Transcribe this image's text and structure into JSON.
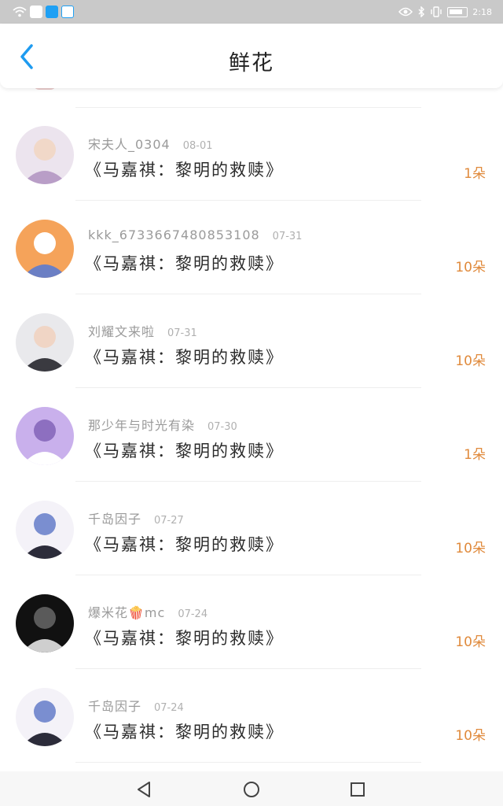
{
  "status_bar": {
    "time": "2:18",
    "icons": [
      "wifi-icon",
      "app-icon",
      "app-icon",
      "app-icon",
      "eye-icon",
      "bluetooth-icon",
      "vibrate-icon",
      "battery-icon"
    ]
  },
  "header": {
    "title": "鲜花",
    "back_icon": "chevron-left-icon"
  },
  "flowers": [
    {
      "username": "宋夫人_0304",
      "date": "08-01",
      "book": "《马嘉祺：黎明的救赎》",
      "count": "1朵",
      "avatar_colors": [
        "#ece4ee",
        "#b99ec7",
        "#f1d8c8"
      ]
    },
    {
      "username": "kkk_6733667480853108",
      "date": "07-31",
      "book": "《马嘉祺：黎明的救赎》",
      "count": "10朵",
      "avatar_colors": [
        "#f5a35a",
        "#6b7fc4",
        "#ffffff"
      ]
    },
    {
      "username": "刘耀文来啦",
      "date": "07-31",
      "book": "《马嘉祺：黎明的救赎》",
      "count": "10朵",
      "avatar_colors": [
        "#e9e9ec",
        "#3a3a40",
        "#f0d5c5"
      ]
    },
    {
      "username": "那少年与时光有染",
      "date": "07-30",
      "book": "《马嘉祺：黎明的救赎》",
      "count": "1朵",
      "avatar_colors": [
        "#c9b0ec",
        "#ffffff",
        "#8d6fc0"
      ]
    },
    {
      "username": "千岛因子",
      "date": "07-27",
      "book": "《马嘉祺：黎明的救赎》",
      "count": "10朵",
      "avatar_colors": [
        "#f4f2f8",
        "#2c2c3a",
        "#7a8ed0"
      ]
    },
    {
      "username": "爆米花🍿mc",
      "date": "07-24",
      "book": "《马嘉祺：黎明的救赎》",
      "count": "10朵",
      "avatar_colors": [
        "#111111",
        "#cfcfcf",
        "#5a5a5a"
      ]
    },
    {
      "username": "千岛因子",
      "date": "07-24",
      "book": "《马嘉祺：黎明的救赎》",
      "count": "10朵",
      "avatar_colors": [
        "#f4f2f8",
        "#2c2c3a",
        "#7a8ed0"
      ]
    }
  ],
  "nav_bar": {
    "back_icon": "triangle-back-icon",
    "home_icon": "circle-home-icon",
    "recents_icon": "square-recents-icon"
  }
}
